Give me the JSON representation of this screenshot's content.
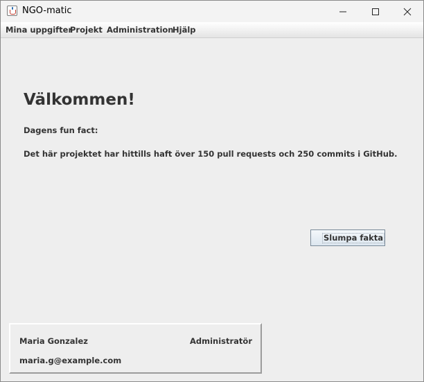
{
  "window": {
    "title": "NGO-matic",
    "icon": "java-cup-icon",
    "controls": [
      "minimize-icon",
      "maximize-icon",
      "close-icon"
    ]
  },
  "menu": {
    "items": [
      "Mina uppgifter",
      "Projekt",
      "Administration",
      "Hjälp"
    ]
  },
  "main": {
    "welcome": "Välkommen!",
    "fun_fact_label": "Dagens fun fact:",
    "fun_fact_text": "Det här projektet har hittills haft över 150 pull requests och 250 commits i GitHub.",
    "random_button_label": "Slumpa fakta"
  },
  "user": {
    "name": "Maria Gonzalez",
    "role": "Administratör",
    "email": "maria.g@example.com"
  }
}
